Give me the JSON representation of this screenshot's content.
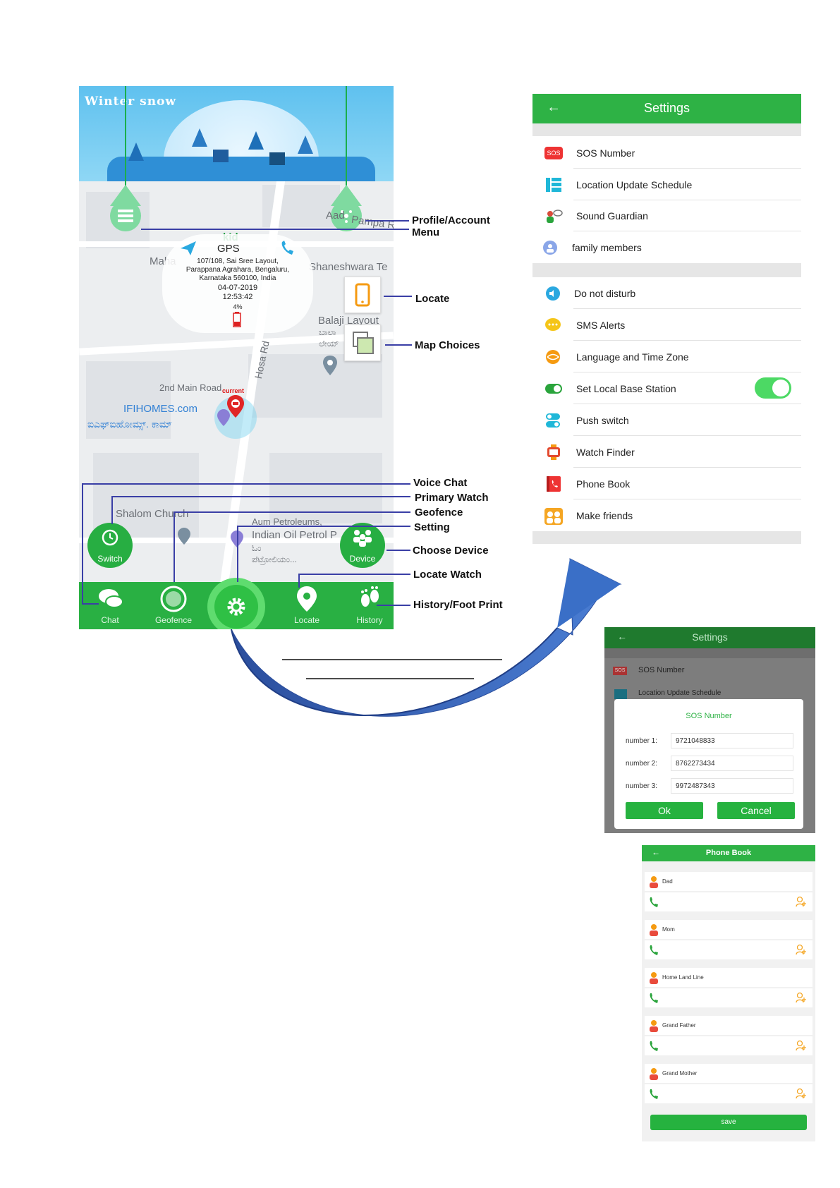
{
  "map": {
    "banner_title": "Winter snow",
    "device_name": "kid",
    "mode": "GPS",
    "address": [
      "107/108, Sai Sree Layout,",
      "Parappana Agrahara, Bengaluru,",
      "Karnataka 560100, India"
    ],
    "date": "04-07-2019",
    "time": "12:53:42",
    "battery": "4%",
    "current_label": "current",
    "labels": {
      "maha": "Maha",
      "aad": "Aad",
      "pampa": "Pampa R",
      "shaneshwara": "Shaneshwara Te",
      "balaji": "Balaji Layout",
      "balaji_kn": "ಬಾಲಾ",
      "balaji_kn2": "ಲೇಯ್",
      "hosa_rd": "Hosa Rd",
      "main_road": "2nd Main Road",
      "ifihomes": "IFIHOMES.com",
      "ifihomes_kn": "ಐಎಫ್‌ಐಹೋಮ್ಸ್. ಕಾಮ್",
      "shalom": "Shalom Church",
      "aum": "Aum Petroleums,",
      "indian_oil": "Indian Oil Petrol P",
      "ind_kn": "ಓಂ",
      "petrol_kn": "ಪೆಟ್ರೋಲಿಯಂ..."
    },
    "switch_label": "Switch",
    "device_label": "Device",
    "tabs": [
      "Chat",
      "Geofence",
      "Locate",
      "History"
    ]
  },
  "callouts": {
    "profile": [
      "Profile/Account",
      "Menu"
    ],
    "locate": "Locate",
    "map_choices": "Map Choices",
    "voice_chat": "Voice Chat",
    "primary_watch": "Primary Watch",
    "geofence": "Geofence",
    "setting": "Setting",
    "choose_device": "Choose Device",
    "locate_watch": "Locate Watch",
    "history": "History/Foot Print"
  },
  "settings": {
    "title": "Settings",
    "back": "←",
    "sos_badge": "SOS",
    "group1": [
      "SOS Number",
      "Location Update Schedule",
      "Sound Guardian",
      "family members"
    ],
    "group2": [
      "Do not disturb",
      "SMS Alerts",
      "Language and Time Zone",
      "Set Local Base Station",
      "Push switch",
      "Watch Finder",
      "Phone Book",
      "Make friends"
    ],
    "base_station_enabled": true
  },
  "sos": {
    "header": "Settings",
    "row1": "SOS Number",
    "row2": "Location Update Schedule",
    "dialog_title": "SOS Number",
    "numbers": [
      {
        "label": "number 1:",
        "value": "9721048833"
      },
      {
        "label": "number 2:",
        "value": "8762273434"
      },
      {
        "label": "number 3:",
        "value": "9972487343"
      }
    ],
    "ok": "Ok",
    "cancel": "Cancel"
  },
  "phonebook": {
    "title": "Phone Book",
    "contacts": [
      "Dad",
      "Mom",
      "Home Land Line",
      "Grand Father",
      "Grand Mother"
    ],
    "save": "save"
  },
  "colors": {
    "brand_green": "#2eb245",
    "callout_line": "#3a3fa6",
    "arrow_blue": "#3a6fc7"
  }
}
